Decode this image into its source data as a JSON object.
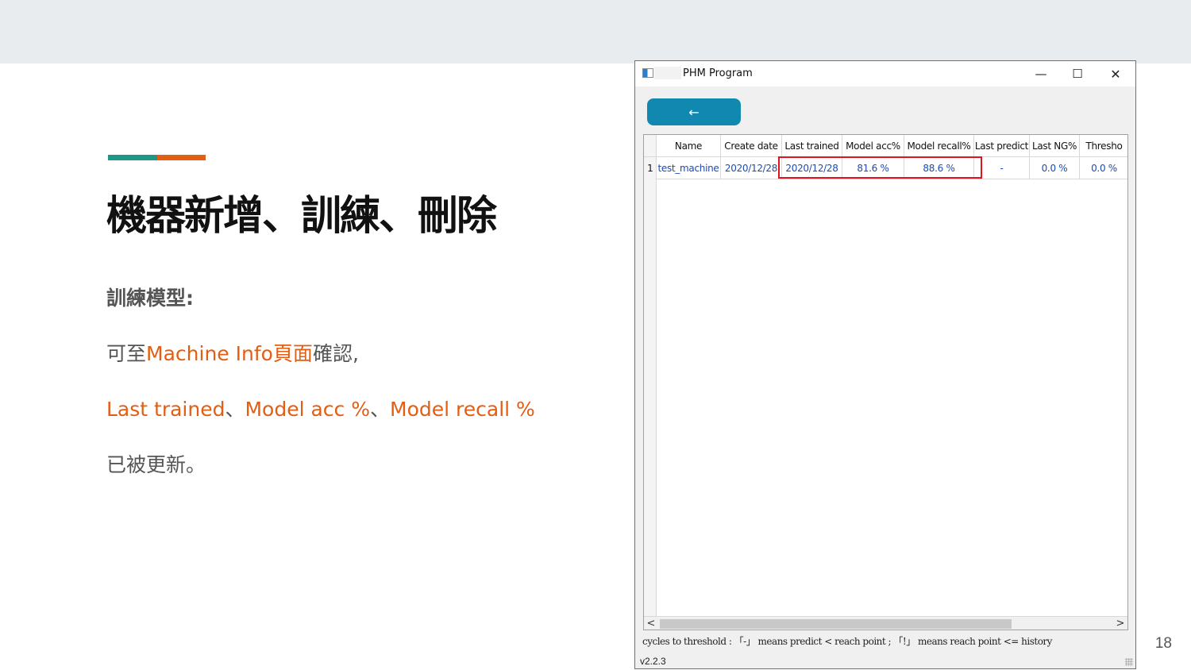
{
  "slide": {
    "title": "機器新增、訓練、刪除",
    "heading": "訓練模型:",
    "line1_prefix": "可至",
    "line1_highlight": "Machine Info頁面",
    "line1_suffix": "確認,",
    "line2_part1": "Last trained",
    "line2_sep1": "、",
    "line2_part2": "Model acc %",
    "line2_sep2": "、",
    "line2_part3": "Model recall %",
    "line3": "已被更新。",
    "page_number": "18"
  },
  "colors": {
    "accent_teal": "#1e9688",
    "accent_orange": "#e35d12",
    "button_blue": "#1188b0",
    "highlight_red": "#e0141e"
  },
  "window": {
    "title": "PHM Program",
    "icon": "app-icon",
    "controls": {
      "minimize": "—",
      "maximize": "☐",
      "close": "✕"
    },
    "back_button": "←",
    "table": {
      "columns": [
        "Name",
        "Create date",
        "Last trained",
        "Model acc%",
        "Model recall%",
        "Last predict",
        "Last NG%",
        "Thresho"
      ],
      "rows": [
        {
          "index": "1",
          "cells": [
            "test_machine",
            "2020/12/28",
            "2020/12/28",
            "81.6 %",
            "88.6 %",
            "-",
            "0.0 %",
            "0.0 %"
          ]
        }
      ]
    },
    "scroll": {
      "left": "<",
      "right": ">"
    },
    "legend": "cycles to threshold : 「-」 means predict < reach point ; 「!」 means reach point <= history",
    "version": "v2.2.3"
  }
}
